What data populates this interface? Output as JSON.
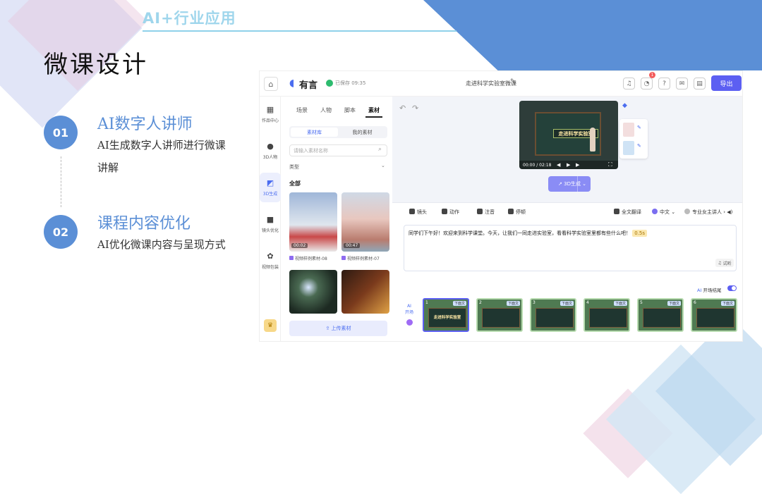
{
  "slide": {
    "section_tag": "AI+行业应用",
    "title": "微课设计",
    "items": [
      {
        "num": "01",
        "heading": "AI数字人讲师",
        "desc_line1": "AI生成数字人讲师进行微课",
        "desc_line2": "讲解"
      },
      {
        "num": "02",
        "heading": "课程内容优化",
        "desc_line1": "AI优化微课内容与呈现方式"
      }
    ]
  },
  "app": {
    "brand": "有言",
    "saved_status": "已保存 09:35",
    "project_title": "走进科学实验室微课",
    "notification_count": "1",
    "export_label": "导出",
    "sidebar": [
      {
        "label": "作品中心",
        "icon": "grid-icon"
      },
      {
        "label": "3D人物",
        "icon": "person-icon"
      },
      {
        "label": "3D生成",
        "icon": "chart-icon",
        "active": true
      },
      {
        "label": "镜头优化",
        "icon": "camera-icon"
      },
      {
        "label": "视频包装",
        "icon": "film-icon"
      }
    ],
    "panel": {
      "tabs": [
        "场景",
        "人物",
        "脚本",
        "素材"
      ],
      "active_tab": "素材",
      "segments": [
        "素材库",
        "我的素材"
      ],
      "search_placeholder": "请输入素材名称",
      "type_label": "类型",
      "all_label": "全部",
      "thumbs": [
        {
          "duration": "00:02",
          "caption": "视频样例素材-08"
        },
        {
          "duration": "00:47",
          "caption": "视频样例素材-07"
        },
        {
          "duration": "",
          "caption": ""
        },
        {
          "duration": "",
          "caption": ""
        }
      ],
      "upload_label": "上传素材"
    },
    "preview": {
      "board_text": "走进科学实验室",
      "time": "00:00 / 02:18",
      "generate_label": "3D生成"
    },
    "toolbar": {
      "shot": "镜头",
      "action": "动作",
      "note": "注音",
      "pause": "停顿",
      "translate": "全文翻译",
      "lang": "中文",
      "voice": "专业女主讲人"
    },
    "script_text": "同学们下午好！欢迎来到科学课堂。今天，让我们一同走进实验室，看看科学实验室里都有些什么吧！",
    "pause_tag": "0.5s",
    "listen_label": "试听",
    "toggle_label": "开场结尾",
    "strip": {
      "ai_label_1": "AI",
      "ai_label_2": "开场",
      "frames": [
        {
          "num": "1",
          "badge": "下面文",
          "title": "走进科学实验室"
        },
        {
          "num": "2",
          "badge": "下面文",
          "title": ""
        },
        {
          "num": "3",
          "badge": "下面文",
          "title": ""
        },
        {
          "num": "4",
          "badge": "下面文",
          "title": ""
        },
        {
          "num": "5",
          "badge": "下面文",
          "title": ""
        },
        {
          "num": "6",
          "badge": "下面文",
          "title": ""
        }
      ]
    }
  }
}
